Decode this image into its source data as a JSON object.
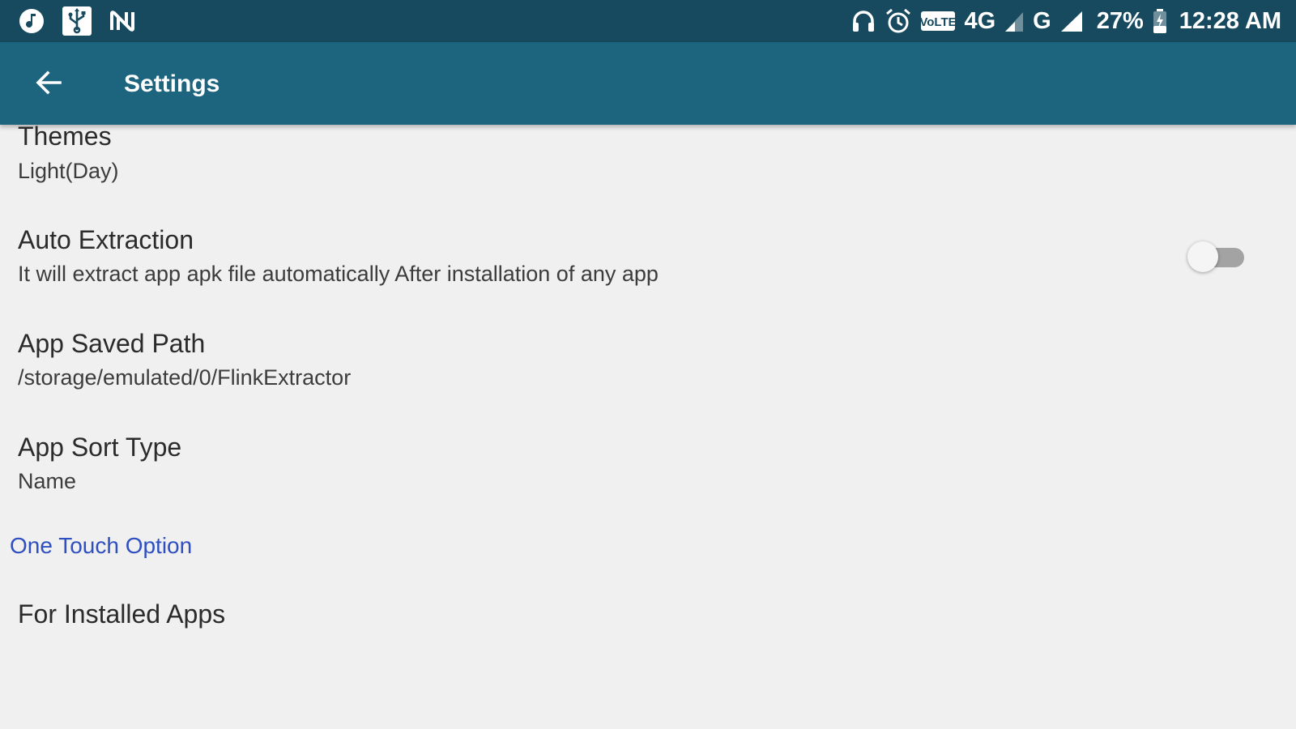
{
  "status_bar": {
    "battery_percent": "27%",
    "time": "12:28 AM",
    "network_4g": "4G",
    "network_g": "G",
    "volte_label": "VoLTE",
    "icons_left": [
      "music-icon",
      "usb-icon",
      "nfc-icon"
    ],
    "icons_right": [
      "headphones-icon",
      "alarm-icon",
      "volte-icon",
      "signal-icon",
      "signal-icon",
      "battery-charging-icon"
    ]
  },
  "app_bar": {
    "title": "Settings",
    "back_icon": "arrow-back-icon",
    "color": "#1d657e"
  },
  "preferences": [
    {
      "title": "Themes",
      "summary": "Light(Day)"
    },
    {
      "title": "Auto Extraction",
      "summary": "It will extract app apk file automatically After installation of any app",
      "switch_on": false
    },
    {
      "title": "App Saved Path",
      "summary": "/storage/emulated/0/FlinkExtractor"
    },
    {
      "title": "App Sort Type",
      "summary": "Name"
    }
  ],
  "category": {
    "title": "One Touch Option",
    "color": "#2e4fbf"
  },
  "category_items": [
    {
      "title": "For Installed Apps"
    }
  ],
  "colors": {
    "status_bar": "#174a5e",
    "background": "#f0f0f0"
  }
}
